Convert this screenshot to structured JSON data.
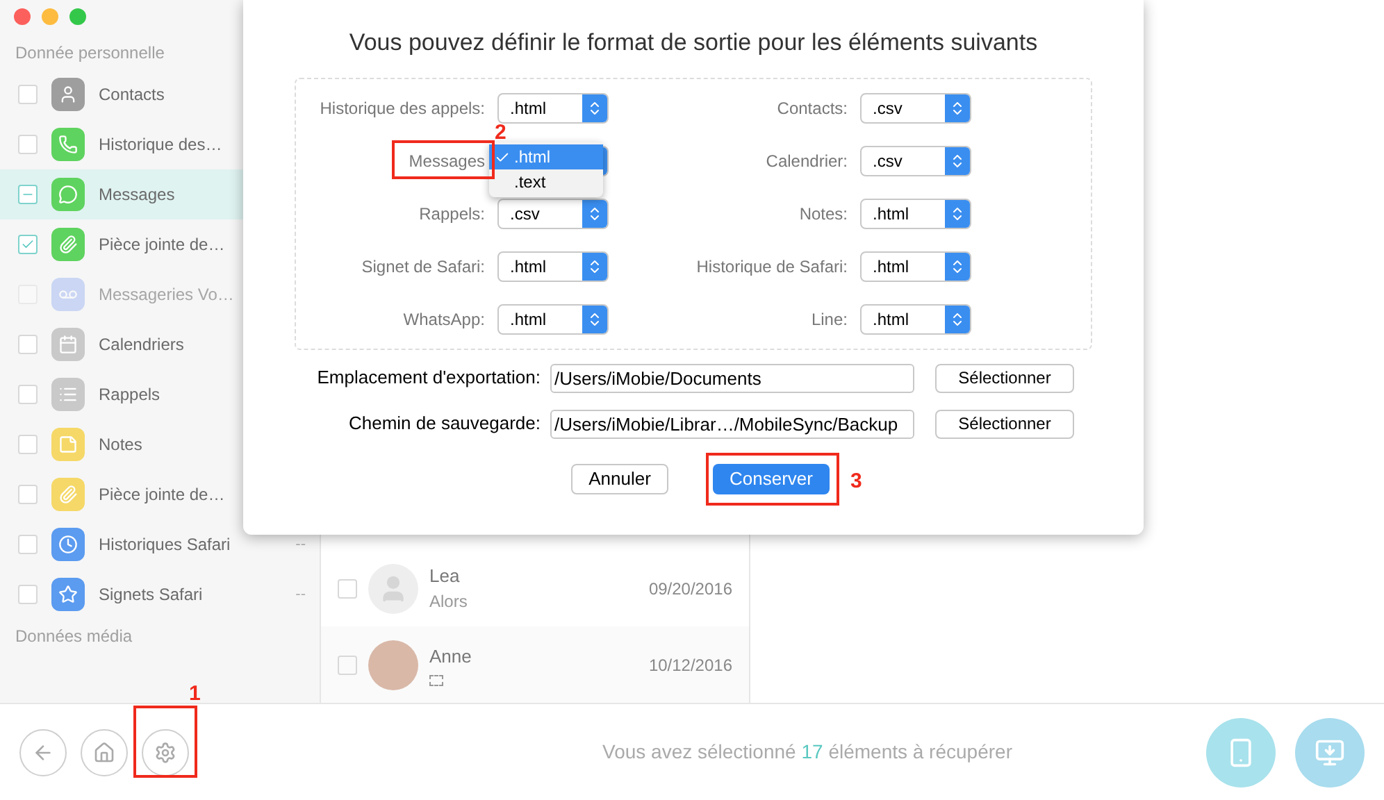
{
  "sidebar": {
    "sections": [
      {
        "title": "Donnée personnelle",
        "items": [
          {
            "label": "Contacts",
            "checked": false,
            "mixed": false,
            "selected": false,
            "disabled": false
          },
          {
            "label": "Historique des…",
            "checked": false,
            "mixed": false,
            "selected": false,
            "disabled": false
          },
          {
            "label": "Messages",
            "checked": true,
            "mixed": true,
            "selected": true,
            "disabled": false
          },
          {
            "label": "Pièce jointe de…",
            "checked": true,
            "mixed": false,
            "selected": false,
            "disabled": false
          },
          {
            "label": "Messageries Vo…",
            "checked": false,
            "mixed": false,
            "selected": false,
            "disabled": true
          },
          {
            "label": "Calendriers",
            "checked": false,
            "mixed": false,
            "selected": false,
            "disabled": false
          },
          {
            "label": "Rappels",
            "checked": false,
            "mixed": false,
            "selected": false,
            "disabled": false
          },
          {
            "label": "Notes",
            "checked": false,
            "mixed": false,
            "selected": false,
            "disabled": false
          },
          {
            "label": "Pièce jointe de…",
            "checked": false,
            "mixed": false,
            "selected": false,
            "disabled": false
          },
          {
            "label": "Historiques Safari",
            "checked": false,
            "mixed": false,
            "selected": false,
            "disabled": false,
            "count": "--"
          },
          {
            "label": "Signets Safari",
            "checked": false,
            "mixed": false,
            "selected": false,
            "disabled": false,
            "count": "--"
          }
        ]
      },
      {
        "title": "Données média"
      }
    ]
  },
  "message_list": [
    {
      "name": "Lea",
      "preview": "Alors",
      "date": "09/20/2016",
      "checked": false,
      "kind": "silhouette"
    },
    {
      "name": "Anne",
      "date": "10/12/2016",
      "checked": false,
      "kind": "photo"
    }
  ],
  "dialog": {
    "title": "Vous pouvez définir le format de sortie pour les éléments suivants",
    "formats": [
      {
        "label": "Historique des appels:",
        "value": ".html"
      },
      {
        "label": "Contacts:",
        "value": ".csv"
      },
      {
        "label": "Messages"
      },
      {
        "label": "Calendrier:",
        "value": ".csv"
      },
      {
        "label": "Rappels:",
        "value": ".csv"
      },
      {
        "label": "Notes:",
        "value": ".html"
      },
      {
        "label": "Signet de Safari:",
        "value": ".html"
      },
      {
        "label": "Historique de Safari:",
        "value": ".html"
      },
      {
        "label": "WhatsApp:",
        "value": ".html"
      },
      {
        "label": "Line:",
        "value": ".html"
      }
    ],
    "menu": [
      {
        "label": ".html",
        "selected": true
      },
      {
        "label": ".text",
        "selected": false
      }
    ],
    "fields": [
      {
        "label": "Emplacement d'exportation:",
        "value": "/Users/iMobie/Documents",
        "button": "Sélectionner"
      },
      {
        "label": "Chemin de sauvegarde:",
        "value": "/Users/iMobie/Librar…/MobileSync/Backup",
        "button": "Sélectionner"
      }
    ],
    "buttons": [
      {
        "label": "Annuler",
        "primary": false
      },
      {
        "label": "Conserver",
        "primary": true
      }
    ]
  },
  "annotations": [
    {
      "number": "1"
    },
    {
      "number": "2"
    },
    {
      "number": "3"
    }
  ],
  "status": {
    "prefix": "Vous avez sélectionné",
    "count": "17",
    "suffix": "éléments à récupérer"
  }
}
